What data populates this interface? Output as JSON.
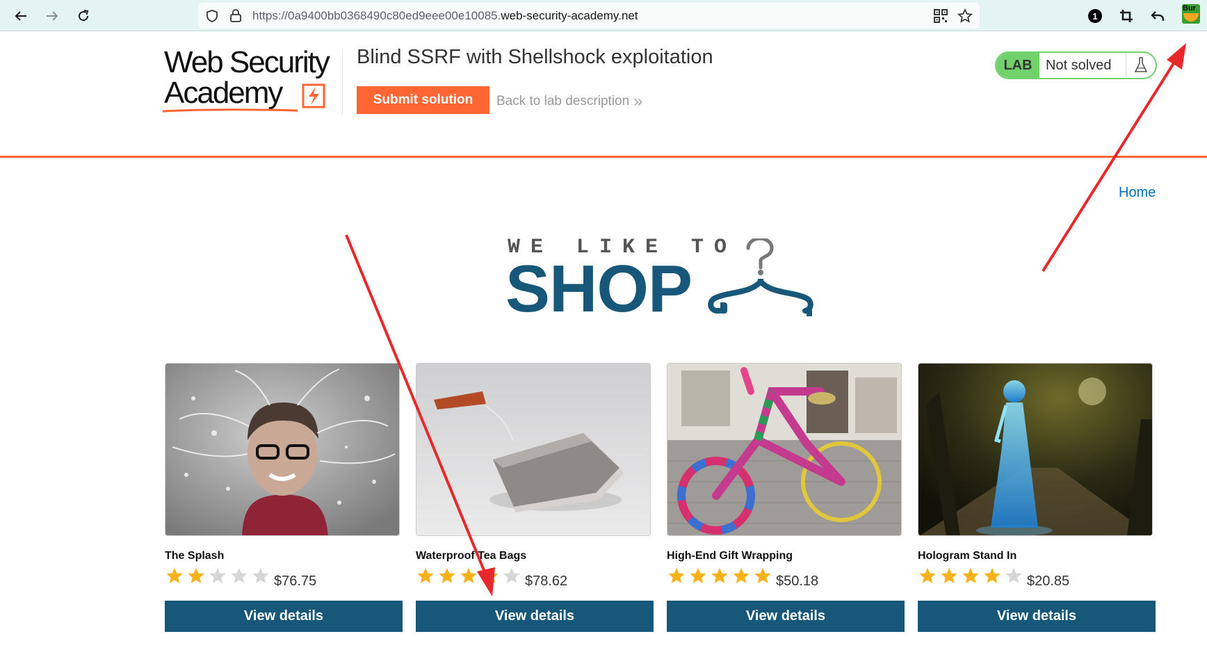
{
  "browser": {
    "url_prefix": "https://0a9400bb0368490c80ed9eee00e10085.",
    "url_domain": "web-security-academy.net",
    "extension_badge": "1",
    "burp_ext_label": "Bur"
  },
  "header": {
    "logo_line1": "Web Security",
    "logo_line2": "Academy",
    "lab_title": "Blind SSRF with Shellshock exploitation",
    "submit_label": "Submit solution",
    "back_label": "Back to lab description",
    "back_chevron": "»",
    "status_tag": "LAB",
    "status_text": "Not solved"
  },
  "nav": {
    "home": "Home"
  },
  "banner": {
    "small": "WE LIKE TO",
    "big": "SHOP"
  },
  "products": [
    {
      "name": "The Splash",
      "rating": 2,
      "price": "$76.75",
      "button": "View details"
    },
    {
      "name": "Waterproof Tea Bags",
      "rating": 4,
      "price": "$78.62",
      "button": "View details"
    },
    {
      "name": "High-End Gift Wrapping",
      "rating": 5,
      "price": "$50.18",
      "button": "View details"
    },
    {
      "name": "Hologram Stand In",
      "rating": 4,
      "price": "$20.85",
      "button": "View details"
    }
  ],
  "colors": {
    "accent_orange": "#ff6633",
    "primary_blue": "#17577a",
    "lab_green": "#70d16d",
    "link_blue": "#0071bc",
    "star_gold": "#f7b21a",
    "star_empty": "#d6d6d6",
    "annotation_red": "#e8282b"
  }
}
